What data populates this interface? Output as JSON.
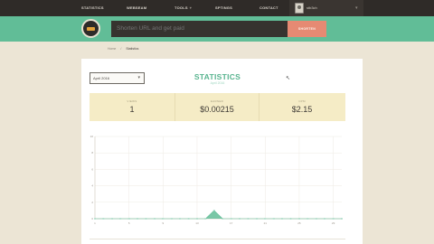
{
  "nav": {
    "items": [
      {
        "label": "STATISTICS",
        "dropdown": false
      },
      {
        "label": "WEBSEAM",
        "dropdown": false
      },
      {
        "label": "TOOLS",
        "dropdown": true
      },
      {
        "label": "SPTINGS",
        "dropdown": false
      },
      {
        "label": "CONTACT",
        "dropdown": false
      }
    ],
    "username": "stb3ch"
  },
  "shorten": {
    "placeholder": "Shorten URL and get paid",
    "button_label": "SHORTEN"
  },
  "breadcrumb": {
    "home": "Home",
    "separator": "/",
    "current": "Statistics"
  },
  "page": {
    "title": "STATISTICS",
    "subtitle": "April 2016"
  },
  "date_select": {
    "selected": "April 2016"
  },
  "stats": [
    {
      "label": "VIEWS",
      "value": "1"
    },
    {
      "label": "EARNED",
      "value": "$0.00215"
    },
    {
      "label": "CPM",
      "value": "$2.15"
    }
  ],
  "chart_data": {
    "type": "area",
    "title": "",
    "xlabel": "",
    "ylabel": "",
    "x_tick_labels": [
      "1",
      "5",
      "9",
      "13",
      "17",
      "21",
      "25",
      "29"
    ],
    "y_tick_labels": [
      "10",
      "8",
      "6",
      "4",
      "2",
      "0"
    ],
    "xlim": [
      1,
      30
    ],
    "ylim": [
      0,
      10
    ],
    "grid": true,
    "series": [
      {
        "color": "#61bd97",
        "x": [
          1,
          2,
          3,
          4,
          5,
          6,
          7,
          8,
          9,
          10,
          11,
          12,
          13,
          14,
          15,
          16,
          17,
          18,
          19,
          20,
          21,
          22,
          23,
          24,
          25,
          26,
          27,
          28,
          29,
          30
        ],
        "values": [
          0,
          0,
          0,
          0,
          0,
          0,
          0,
          0,
          0,
          0,
          0,
          0,
          0,
          0,
          1,
          0,
          0,
          0,
          0,
          0,
          0,
          0,
          0,
          0,
          0,
          0,
          0,
          0,
          0,
          0
        ]
      }
    ]
  },
  "colors": {
    "nav_bg": "#2f2b28",
    "accent_green": "#61bd97",
    "button_coral": "#e68a73",
    "stats_band": "#f5ecc6",
    "page_bg": "#ece5d5"
  }
}
